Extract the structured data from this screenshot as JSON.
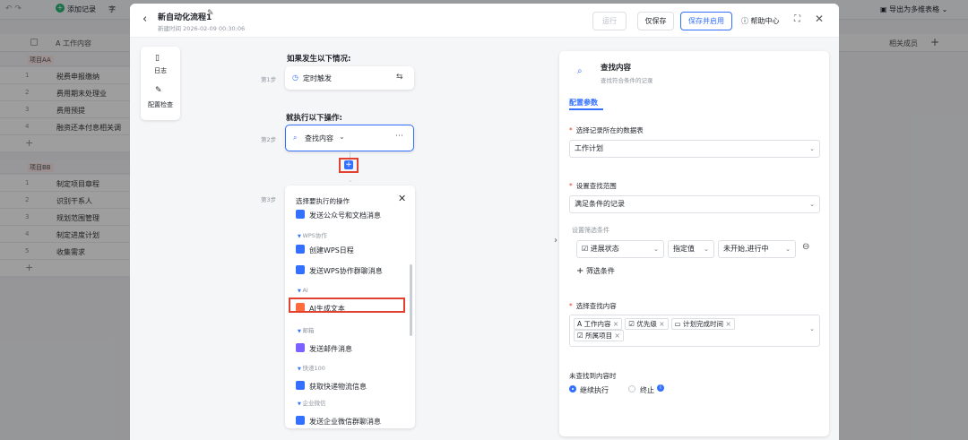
{
  "background": {
    "add_record": "添加记录",
    "field_btn": "字",
    "export": "导出为多维表格",
    "col_work": "A 工作内容",
    "col_members": "相关成员",
    "groups": [
      {
        "label": "项目AA",
        "rows": [
          {
            "n": "1",
            "t": "税费申报缴纳"
          },
          {
            "n": "2",
            "t": "费用期末处理业"
          },
          {
            "n": "3",
            "t": "费用预提"
          },
          {
            "n": "4",
            "t": "融资还本付息相关调"
          }
        ]
      },
      {
        "label": "项目BB",
        "rows": [
          {
            "n": "1",
            "t": "制定项目章程"
          },
          {
            "n": "2",
            "t": "识别干系人"
          },
          {
            "n": "3",
            "t": "规划范围管理"
          },
          {
            "n": "4",
            "t": "制定进度计划"
          },
          {
            "n": "5",
            "t": "收集需求"
          }
        ]
      }
    ]
  },
  "dialog": {
    "title": "新自动化流程1",
    "subtitle": "新建时间 2026-02-09 00:30:06",
    "run": "运行",
    "save": "仅保存",
    "save_enable": "保存并启用",
    "help": "帮助中心"
  },
  "left_tools": {
    "log": "日志",
    "check": "配置检查"
  },
  "flow": {
    "trigger_heading": "如果发生以下情况:",
    "step1": "第1步",
    "trigger": "定时触发",
    "action_heading": "就执行以下操作:",
    "step2": "第2步",
    "action": "查找内容",
    "step3": "第3步"
  },
  "menu": {
    "title": "选择要执行的操作",
    "items": [
      {
        "type": "item",
        "label": "发送公众号和文档消息",
        "color": "#3370ff"
      },
      {
        "type": "section",
        "label": "WPS协作"
      },
      {
        "type": "item",
        "label": "创建WPS日程",
        "color": "#3370ff"
      },
      {
        "type": "item",
        "label": "发送WPS协作群聊消息",
        "color": "#3370ff"
      },
      {
        "type": "section",
        "label": "AI"
      },
      {
        "type": "item",
        "label": "AI生成文本",
        "color": "#ff6b3d"
      },
      {
        "type": "section",
        "label": "邮箱"
      },
      {
        "type": "item",
        "label": "发送邮件消息",
        "color": "#7b61ff"
      },
      {
        "type": "section",
        "label": "快递100"
      },
      {
        "type": "item",
        "label": "获取快递物流信息",
        "color": "#3370ff"
      },
      {
        "type": "section",
        "label": "企业微信"
      },
      {
        "type": "item",
        "label": "发送企业微信群聊消息",
        "color": "#3370ff"
      }
    ]
  },
  "panel": {
    "title": "查找内容",
    "desc": "查找符合条件的记录",
    "tab": "配置参数",
    "table_label": "选择记录所在的数据表",
    "table_value": "工作计划",
    "range_label": "设置查找范围",
    "range_value": "满足条件的记录",
    "filter_label": "设置筛选条件",
    "filter_field": "进展状态",
    "filter_op": "指定值",
    "filter_val": "未开始,进行中",
    "add_filter": "筛选条件",
    "content_label": "选择查找内容",
    "tags": [
      "工作内容",
      "优先级",
      "计划完成时间",
      "所属项目"
    ],
    "notfound_label": "未查找到内容时",
    "opt_continue": "继续执行",
    "opt_stop": "终止"
  },
  "colors": {
    "accent": "#3370ff",
    "highlight": "#e2412f"
  }
}
